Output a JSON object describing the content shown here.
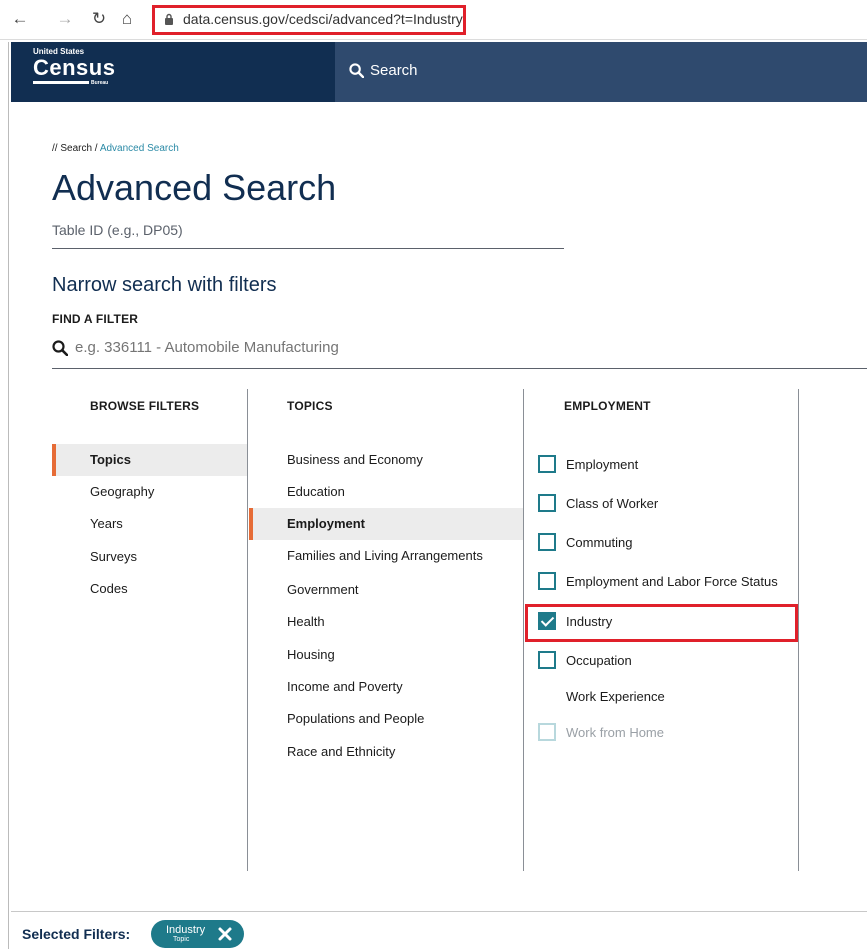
{
  "browser": {
    "url": "data.census.gov/cedsci/advanced?t=Industry"
  },
  "header": {
    "logo_top": "United States",
    "logo_main": "Census",
    "logo_bottom": "Bureau",
    "search_label": "Search"
  },
  "breadcrumb": {
    "root": "// Search",
    "separator": " / ",
    "current": "Advanced Search"
  },
  "page_title": "Advanced Search",
  "table_id_placeholder": "Table ID (e.g., DP05)",
  "narrow_title": "Narrow search with filters",
  "find_filter_label": "FIND A FILTER",
  "filter_search_placeholder": "e.g. 336111 - Automobile Manufacturing",
  "browse": {
    "heading": "BROWSE FILTERS",
    "items": [
      "Topics",
      "Geography",
      "Years",
      "Surveys",
      "Codes"
    ],
    "active": "Topics"
  },
  "topics": {
    "heading": "TOPICS",
    "items": [
      "Business and Economy",
      "Education",
      "Employment",
      "Families and Living Arrangements",
      "Government",
      "Health",
      "Housing",
      "Income and Poverty",
      "Populations and People",
      "Race and Ethnicity"
    ],
    "active": "Employment"
  },
  "employment": {
    "heading": "EMPLOYMENT",
    "items": [
      {
        "label": "Employment",
        "state": "unchecked"
      },
      {
        "label": "Class of Worker",
        "state": "unchecked"
      },
      {
        "label": "Commuting",
        "state": "unchecked"
      },
      {
        "label": "Employment and Labor Force Status",
        "state": "unchecked"
      },
      {
        "label": "Industry",
        "state": "checked"
      },
      {
        "label": "Occupation",
        "state": "unchecked"
      },
      {
        "label": "Work Experience",
        "state": "none"
      },
      {
        "label": "Work from Home",
        "state": "disabled"
      }
    ]
  },
  "footer": {
    "selected_label": "Selected Filters:",
    "chip_name": "Industry",
    "chip_category": "Topic"
  },
  "colors": {
    "navy": "#112e51",
    "header_right": "#2f4a6e",
    "teal": "#1e7a8a",
    "accent": "#e66c37",
    "highlight": "#e0202a"
  }
}
